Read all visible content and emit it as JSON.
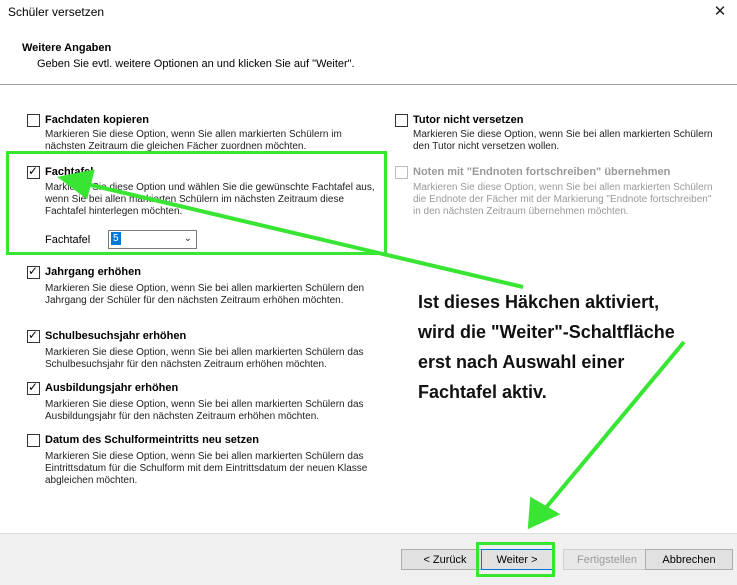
{
  "window": {
    "title": "Schüler versetzen",
    "close_glyph": "✕"
  },
  "header": {
    "title": "Weitere Angaben",
    "subtitle": "Geben Sie evtl. weitere Optionen an und klicken Sie auf \"Weiter\"."
  },
  "options_left": [
    {
      "label": "Fachdaten kopieren",
      "checked": false,
      "desc": "Markieren Sie diese Option, wenn Sie allen markierten Schülern im nächsten Zeitraum die gleichen Fächer zuordnen möchten."
    },
    {
      "label": "Fachtafel",
      "checked": true,
      "desc": "Markieren Sie diese Option und wählen Sie die gewünschte Fachtafel aus, wenn Sie bei allen markierten Schülern im nächsten Zeitraum diese Fachtafel hinterlegen möchten.",
      "select_label": "Fachtafel",
      "select_value": "5"
    },
    {
      "label": "Jahrgang erhöhen",
      "checked": true,
      "desc": "Markieren Sie diese Option, wenn Sie bei allen markierten Schülern den Jahrgang der Schüler für den nächsten Zeitraum erhöhen möchten."
    },
    {
      "label": "Schulbesuchsjahr erhöhen",
      "checked": true,
      "desc": "Markieren Sie diese Option, wenn Sie bei allen markierten Schülern das Schulbesuchsjahr für den nächsten Zeitraum erhöhen möchten."
    },
    {
      "label": "Ausbildungsjahr erhöhen",
      "checked": true,
      "desc": "Markieren Sie diese Option, wenn Sie bei allen markierten Schülern das Ausbildungsjahr für den nächsten Zeitraum erhöhen möchten."
    },
    {
      "label": "Datum des Schulformeintritts neu setzen",
      "checked": false,
      "desc": "Markieren Sie diese Option, wenn Sie bei allen markierten Schülern das Eintrittsdatum für die Schulform mit dem Eintrittsdatum der neuen Klasse abgleichen möchten."
    }
  ],
  "options_right": [
    {
      "label": "Tutor nicht versetzen",
      "checked": false,
      "disabled": false,
      "desc": "Markieren Sie diese Option, wenn Sie bei allen markierten Schülern den Tutor nicht versetzen wollen."
    },
    {
      "label": "Noten mit \"Endnoten fortschreiben\" übernehmen",
      "checked": false,
      "disabled": true,
      "desc": "Markieren Sie diese Option, wenn Sie bei allen markierten Schülern die Endnote der Fächer mit der Markierung \"Endnote fortschreiben\" in den nächsten Zeitraum übernehmen möchten."
    }
  ],
  "annotation": {
    "lines": [
      "Ist dieses Häkchen aktiviert,",
      "wird die \"Weiter\"-Schaltfläche",
      "erst nach Auswahl einer",
      "Fachtafel aktiv."
    ],
    "color": "#39e533"
  },
  "footer": {
    "back_label": "< Zurück",
    "next_label": "Weiter >",
    "finish_label": "Fertigstellen",
    "cancel_label": "Abbrechen"
  }
}
